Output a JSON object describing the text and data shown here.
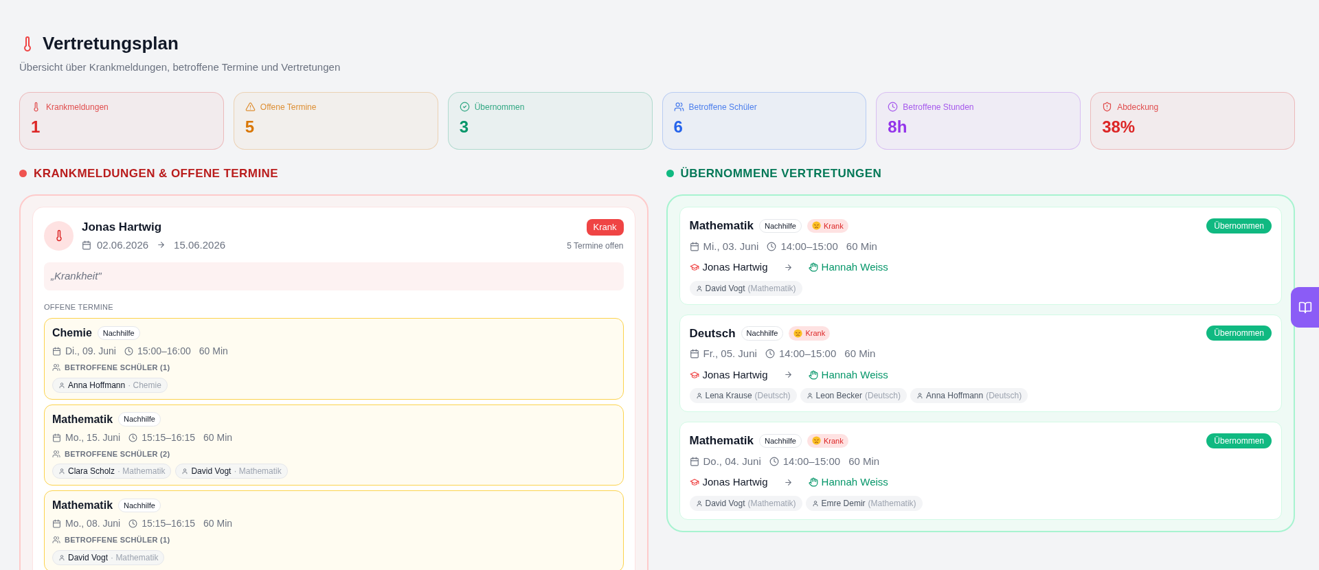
{
  "header": {
    "title": "Vertretungsplan",
    "subtitle": "Übersicht über Krankmeldungen, betroffene Termine und Vertretungen"
  },
  "stats": [
    {
      "kind": "thermometer",
      "label": "Krankmeldungen",
      "value": "1",
      "color": "#dc2626"
    },
    {
      "kind": "warning",
      "label": "Offene Termine",
      "value": "5",
      "color": "#d97706"
    },
    {
      "kind": "check",
      "label": "Übernommen",
      "value": "3",
      "color": "#059669"
    },
    {
      "kind": "users",
      "label": "Betroffene Schüler",
      "value": "6",
      "color": "#2563eb"
    },
    {
      "kind": "clock",
      "label": "Betroffene Stunden",
      "value": "8h",
      "color": "#9333ea"
    },
    {
      "kind": "shield",
      "label": "Abdeckung",
      "value": "38%",
      "color": "#dc2626"
    }
  ],
  "sick_section": {
    "heading": "KRANKMELDUNGEN & OFFENE TERMINE",
    "reports": [
      {
        "name": "Jonas Hartwig",
        "from": "02.06.2026",
        "to": "15.06.2026",
        "status": "Krank",
        "open_count": "5 Termine offen",
        "reason": "„Krankheit\"",
        "appointments_heading": "OFFENE TERMINE",
        "appointments": [
          {
            "subject": "Chemie",
            "type": "Nachhilfe",
            "date": "Di., 09. Juni",
            "time": "15:00–16:00",
            "duration": "60 Min",
            "students_heading": "BETROFFENE SCHÜLER (1)",
            "students": [
              {
                "name": "Anna Hoffmann",
                "subject": "· Chemie"
              }
            ]
          },
          {
            "subject": "Mathematik",
            "type": "Nachhilfe",
            "date": "Mo., 15. Juni",
            "time": "15:15–16:15",
            "duration": "60 Min",
            "students_heading": "BETROFFENE SCHÜLER (2)",
            "students": [
              {
                "name": "Clara Scholz",
                "subject": "· Mathematik"
              },
              {
                "name": "David Vogt",
                "subject": "· Mathematik"
              }
            ]
          },
          {
            "subject": "Mathematik",
            "type": "Nachhilfe",
            "date": "Mo., 08. Juni",
            "time": "15:15–16:15",
            "duration": "60 Min",
            "students_heading": "BETROFFENE SCHÜLER (1)",
            "students": [
              {
                "name": "David Vogt",
                "subject": "· Mathematik"
              }
            ]
          }
        ]
      }
    ]
  },
  "takeover_section": {
    "heading": "ÜBERNOMMENE VERTRETUNGEN",
    "items": [
      {
        "subject": "Mathematik",
        "type": "Nachhilfe",
        "reason": "Krank",
        "status": "Übernommen",
        "date": "Mi., 03. Juni",
        "time": "14:00–15:00",
        "duration": "60 Min",
        "absent_teacher": "Jonas Hartwig",
        "substitute": "Hannah Weiss",
        "students": [
          {
            "name": "David Vogt",
            "subject": "(Mathematik)"
          }
        ]
      },
      {
        "subject": "Deutsch",
        "type": "Nachhilfe",
        "reason": "Krank",
        "status": "Übernommen",
        "date": "Fr., 05. Juni",
        "time": "14:00–15:00",
        "duration": "60 Min",
        "absent_teacher": "Jonas Hartwig",
        "substitute": "Hannah Weiss",
        "students": [
          {
            "name": "Lena Krause",
            "subject": "(Deutsch)"
          },
          {
            "name": "Leon Becker",
            "subject": "(Deutsch)"
          },
          {
            "name": "Anna Hoffmann",
            "subject": "(Deutsch)"
          }
        ]
      },
      {
        "subject": "Mathematik",
        "type": "Nachhilfe",
        "reason": "Krank",
        "status": "Übernommen",
        "date": "Do., 04. Juni",
        "time": "14:00–15:00",
        "duration": "60 Min",
        "absent_teacher": "Jonas Hartwig",
        "substitute": "Hannah Weiss",
        "students": [
          {
            "name": "David Vogt",
            "subject": "(Mathematik)"
          },
          {
            "name": "Emre Demir",
            "subject": "(Mathematik)"
          }
        ]
      }
    ]
  }
}
